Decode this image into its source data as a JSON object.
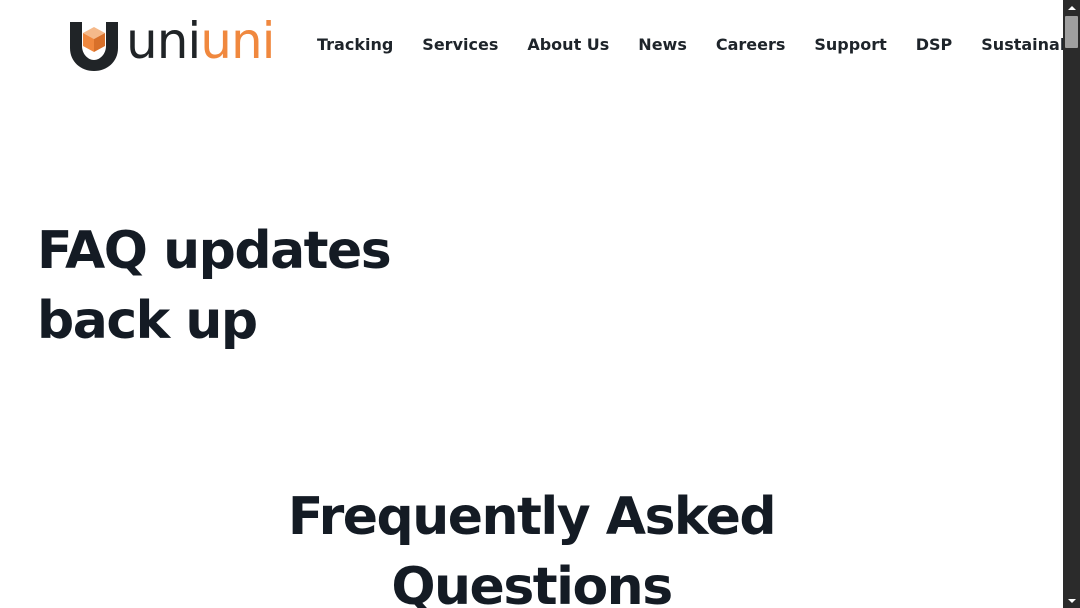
{
  "brand": {
    "logo_icon": "box-shield-logo-icon",
    "name_part1": "uni",
    "name_part2": "uni",
    "colors": {
      "dark": "#202427",
      "orange": "#f0883e"
    }
  },
  "nav": {
    "items": [
      {
        "label": "Tracking"
      },
      {
        "label": "Services"
      },
      {
        "label": "About Us"
      },
      {
        "label": "News"
      },
      {
        "label": "Careers"
      },
      {
        "label": "Support"
      },
      {
        "label": "DSP"
      },
      {
        "label": "Sustainability"
      }
    ]
  },
  "hero": {
    "title_line1": "FAQ updates",
    "title_line2": "back up"
  },
  "faq": {
    "heading_line1": "Frequently Asked",
    "heading_line2": "Questions"
  },
  "scrollbar": {
    "up_icon": "arrow-up-icon",
    "down_icon": "arrow-down-icon"
  }
}
